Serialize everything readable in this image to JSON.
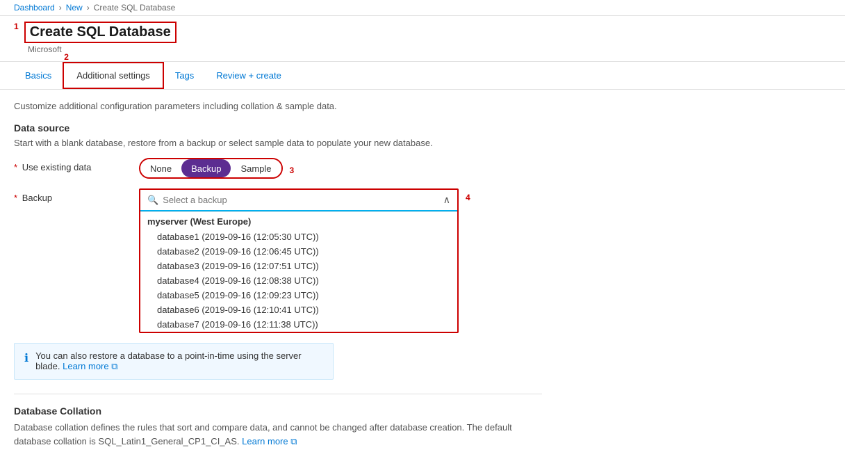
{
  "breadcrumb": {
    "items": [
      "Dashboard",
      "New",
      "Create SQL Database"
    ]
  },
  "header": {
    "annotation": "1",
    "title": "Create SQL Database",
    "subtitle": "Microsoft"
  },
  "tabs": {
    "annotation": "2",
    "items": [
      {
        "label": "Basics",
        "active": false
      },
      {
        "label": "Additional settings",
        "active": true
      },
      {
        "label": "Tags",
        "active": false
      },
      {
        "label": "Review + create",
        "active": false
      }
    ]
  },
  "description": "Customize additional configuration parameters including collation & sample data.",
  "data_source_section": {
    "title": "Data source",
    "description": "Start with a blank database, restore from a backup or select sample data to populate your new database.",
    "use_existing_data": {
      "label": "Use existing data",
      "required": true,
      "annotation": "3",
      "options": [
        "None",
        "Backup",
        "Sample"
      ],
      "selected": "Backup"
    },
    "backup": {
      "label": "Backup",
      "required": true,
      "annotation": "4",
      "placeholder": "Select a backup",
      "server_group": "myserver (West Europe)",
      "items": [
        "database1 (2019-09-16 (12:05:30 UTC))",
        "database2 (2019-09-16 (12:06:45 UTC))",
        "database3 (2019-09-16 (12:07:51 UTC))",
        "database4 (2019-09-16 (12:08:38 UTC))",
        "database5 (2019-09-16 (12:09:23 UTC))",
        "database6 (2019-09-16 (12:10:41 UTC))",
        "database7 (2019-09-16 (12:11:38 UTC))"
      ]
    },
    "info": {
      "text": "You can also restore a database to a point-in-time using the server blade.",
      "link_text": "Learn more",
      "icon": "ℹ"
    }
  },
  "collation_section": {
    "title": "Database Collation",
    "description": "Database collation defines the rules that sort and compare data, and cannot be changed after database creation. The default database collation is SQL_Latin1_General_CP1_CI_AS.",
    "link_text": "Learn more"
  },
  "icons": {
    "search": "🔍",
    "chevron_up": "∧",
    "info": "ℹ",
    "external_link": "⧉"
  }
}
